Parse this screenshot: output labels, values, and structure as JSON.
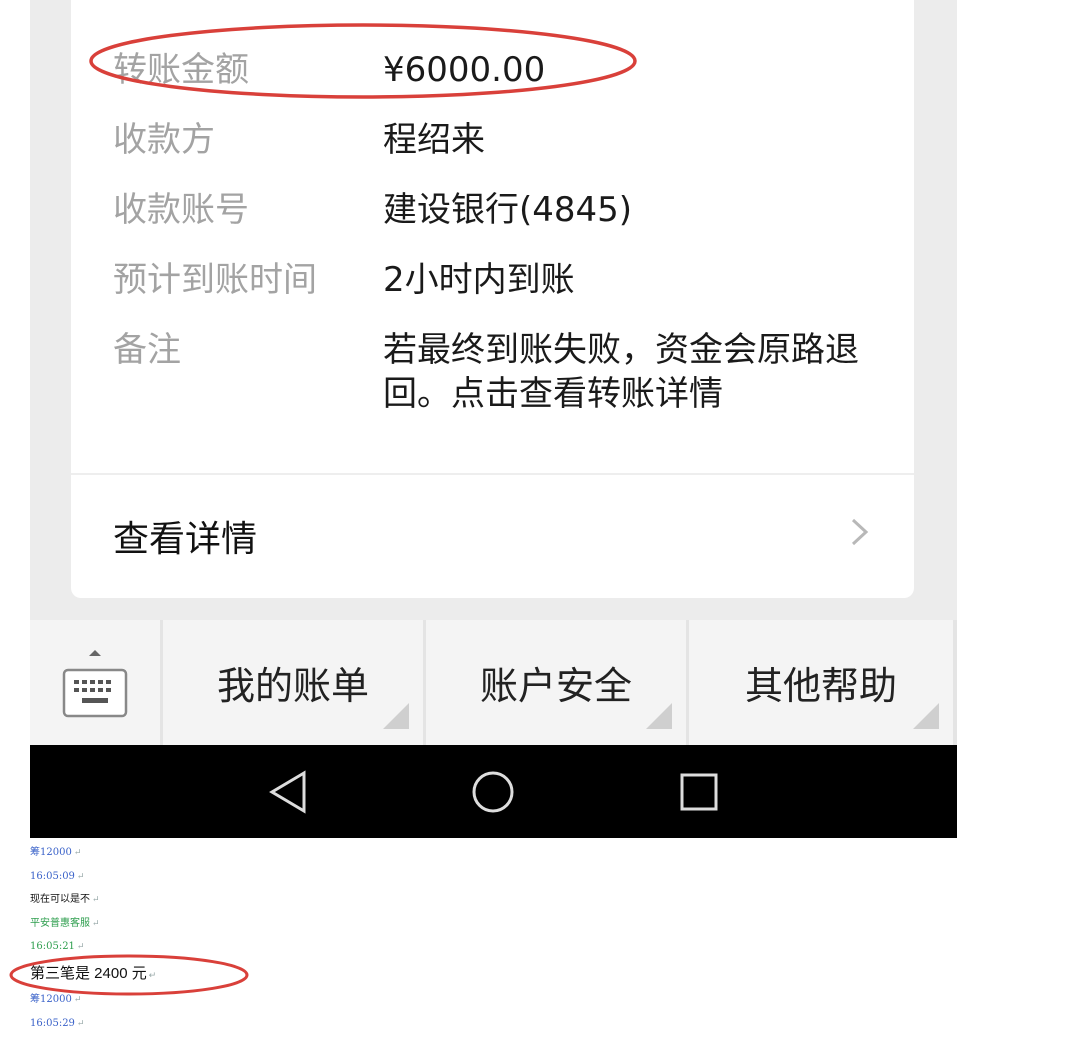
{
  "transfer": {
    "rows": [
      {
        "label": "转账金额",
        "value": "¥6000.00"
      },
      {
        "label": "收款方",
        "value": "程绍来"
      },
      {
        "label": "收款账号",
        "value": "建设银行(4845)"
      },
      {
        "label": "预计到账时间",
        "value": "2小时内到账"
      },
      {
        "label": "备注",
        "value": "若最终到账失败，资金会原路退回。点击查看转账详情"
      }
    ],
    "view_details": "查看详情"
  },
  "menu": {
    "items": [
      "我的账单",
      "账户安全",
      "其他帮助"
    ]
  },
  "chat": {
    "lines": [
      {
        "text": "筹12000",
        "color": "blue"
      },
      {
        "text": "16:05:09",
        "color": "blue"
      },
      {
        "text": "现在可以是不",
        "color": "black"
      },
      {
        "text": "平安普惠客服",
        "color": "green"
      },
      {
        "text": "16:05:21",
        "color": "green"
      },
      {
        "text": "第三笔是 2400 元",
        "color": "black"
      },
      {
        "text": "筹12000",
        "color": "blue"
      },
      {
        "text": "16:05:29",
        "color": "blue"
      }
    ]
  },
  "colors": {
    "highlight_ellipse": "#d9403a",
    "navbar": "#000000",
    "card": "#ffffff",
    "background": "#ececec"
  }
}
